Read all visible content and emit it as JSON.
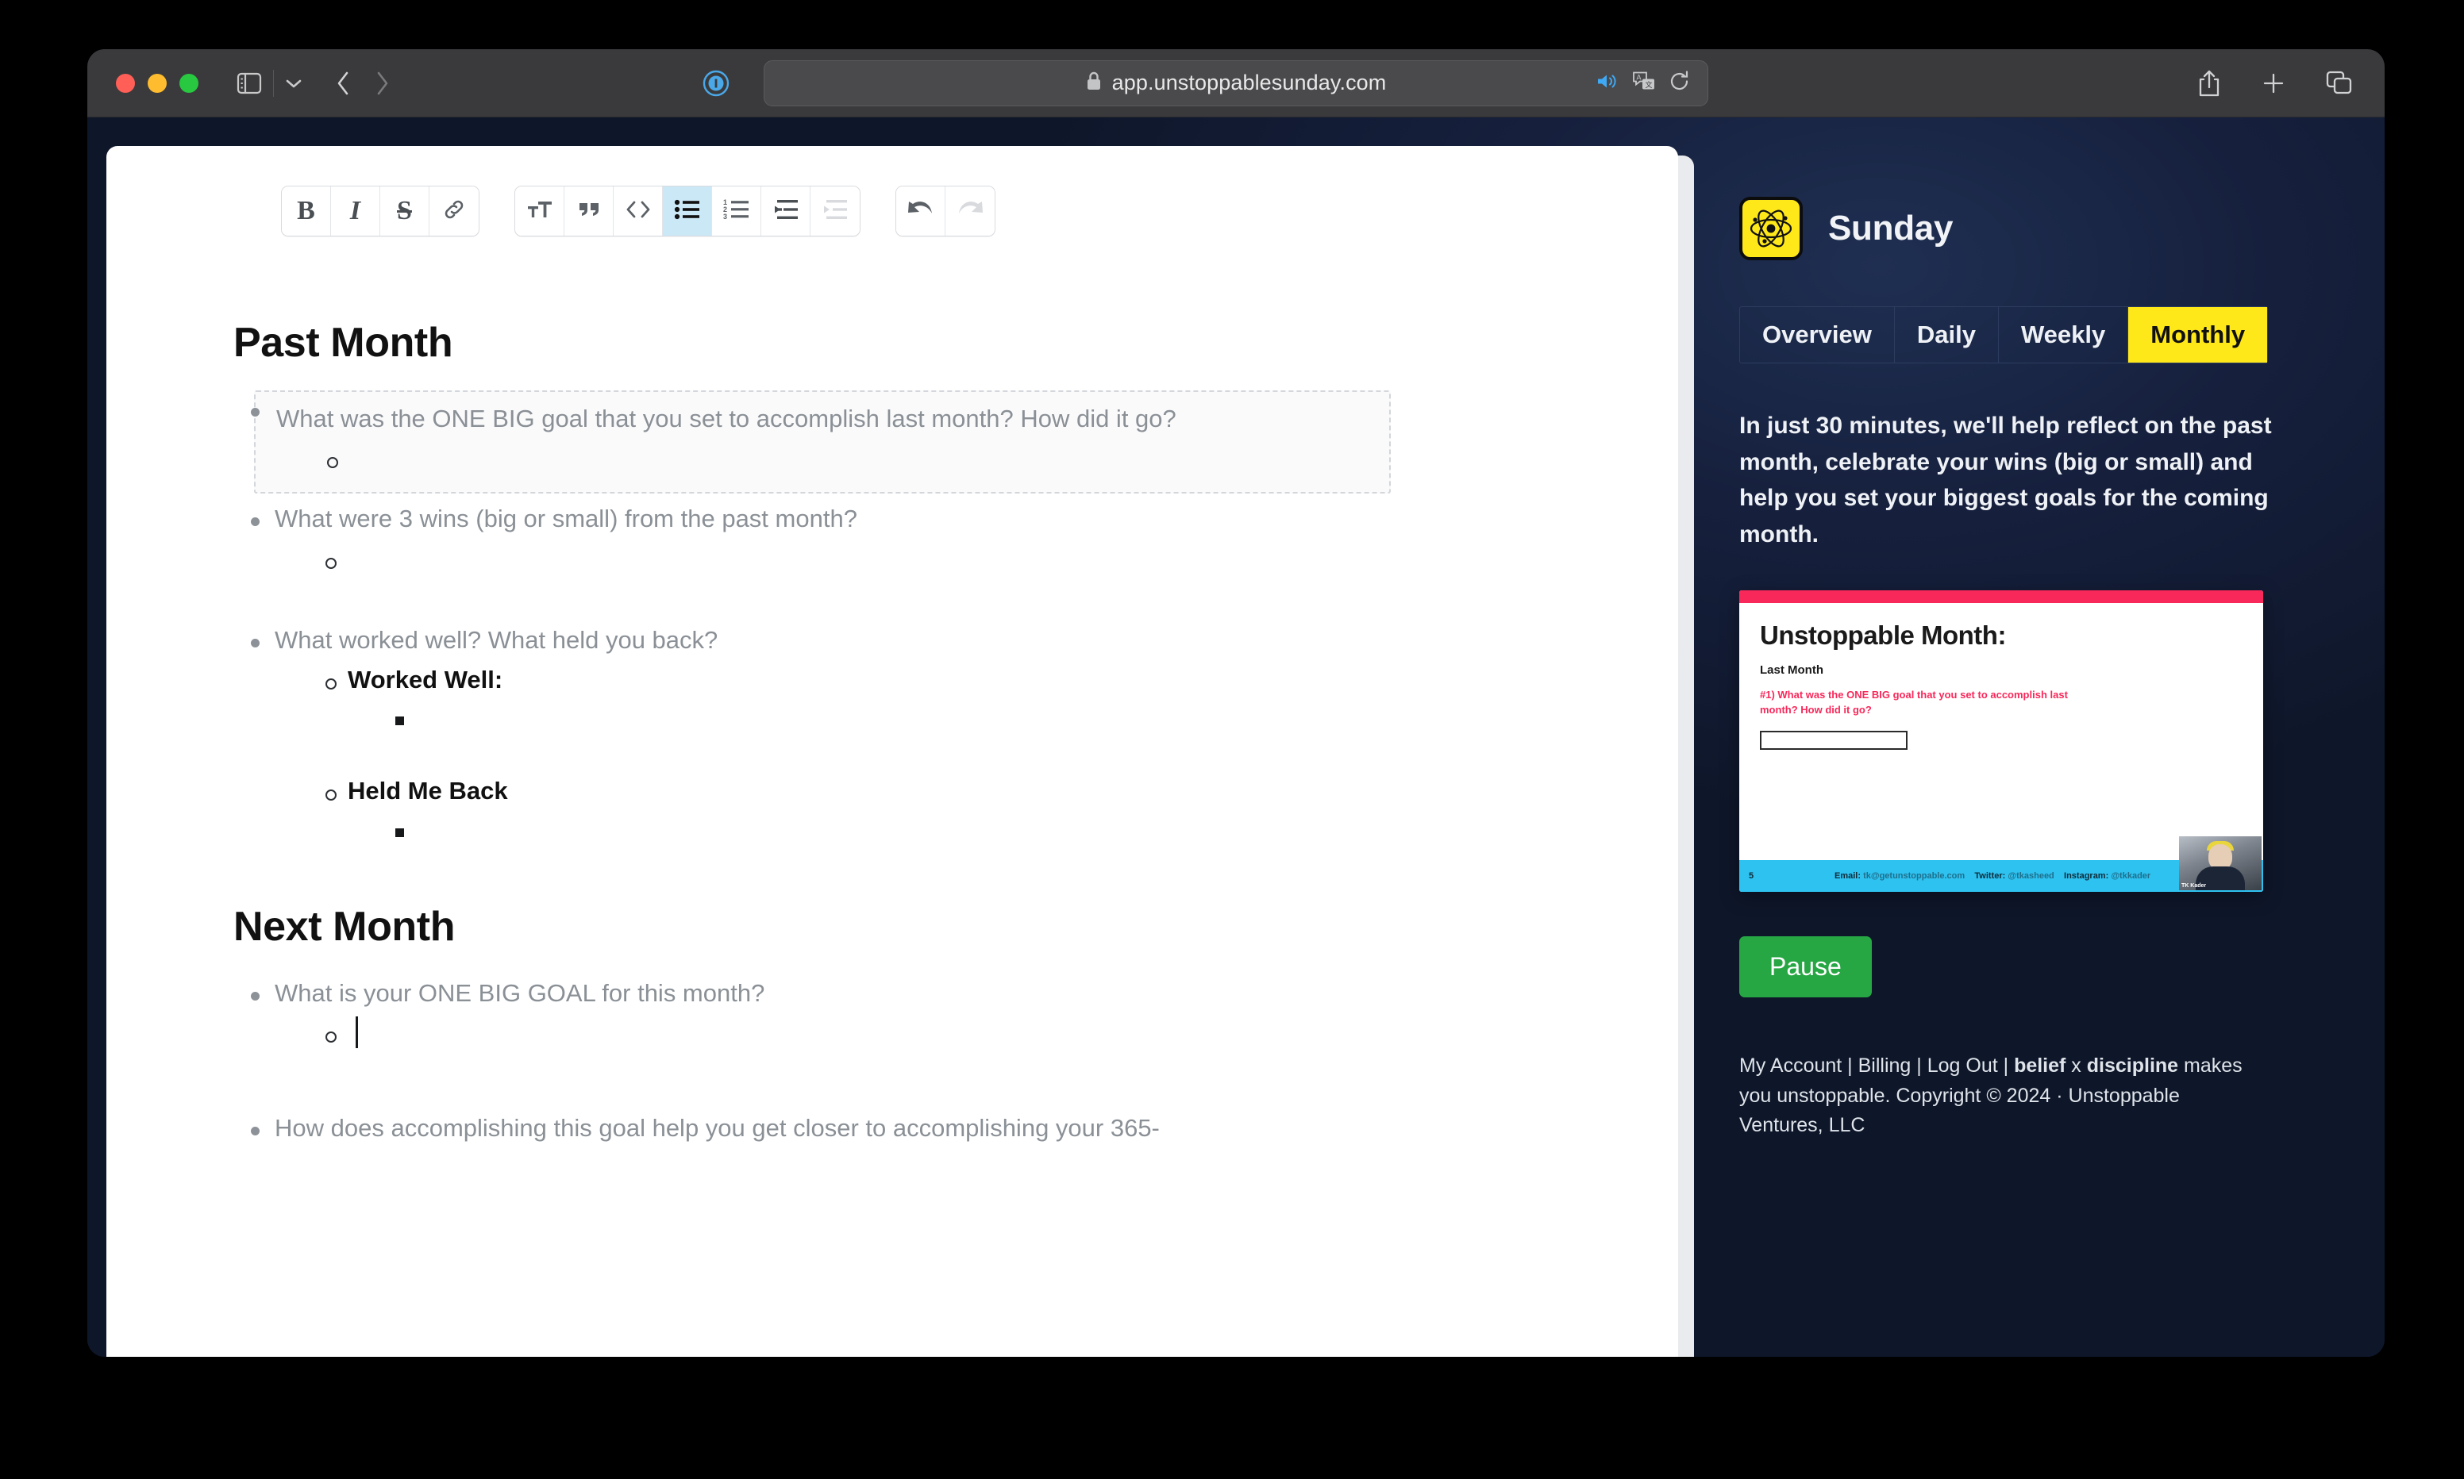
{
  "browser": {
    "url": "app.unstoppablesunday.com",
    "lock_icon": "lock-icon",
    "sidebar_icon": "sidebar-toggle-icon",
    "back_icon": "back-arrow-icon",
    "forward_icon": "forward-arrow-icon",
    "reader_icon": "reader-mode-icon",
    "shield_icon": "privacy-shield-icon",
    "audio_icon": "audio-playing-icon",
    "translate_icon": "translate-icon",
    "reload_icon": "reload-icon",
    "share_icon": "share-icon",
    "newtab_icon": "new-tab-icon",
    "tabs_icon": "tab-overview-icon"
  },
  "editor_toolbar": {
    "groups": [
      {
        "name": "inline-format",
        "buttons": [
          {
            "name": "bold-button",
            "icon": "bold-icon",
            "label": "B",
            "state": "normal"
          },
          {
            "name": "italic-button",
            "icon": "italic-icon",
            "label": "I",
            "state": "normal"
          },
          {
            "name": "strikethrough-button",
            "icon": "strikethrough-icon",
            "label": "S",
            "state": "normal"
          },
          {
            "name": "link-button",
            "icon": "link-icon",
            "label": "",
            "state": "normal"
          }
        ]
      },
      {
        "name": "block-format",
        "buttons": [
          {
            "name": "heading-button",
            "icon": "text-size-icon",
            "label": "",
            "state": "normal"
          },
          {
            "name": "blockquote-button",
            "icon": "quote-icon",
            "label": "",
            "state": "normal"
          },
          {
            "name": "code-button",
            "icon": "code-icon",
            "label": "",
            "state": "normal"
          },
          {
            "name": "bulleted-list-button",
            "icon": "bulleted-list-icon",
            "label": "",
            "state": "active"
          },
          {
            "name": "numbered-list-button",
            "icon": "numbered-list-icon",
            "label": "",
            "state": "normal"
          },
          {
            "name": "outdent-button",
            "icon": "outdent-icon",
            "label": "",
            "state": "normal"
          },
          {
            "name": "indent-button",
            "icon": "indent-icon",
            "label": "",
            "state": "disabled"
          }
        ]
      },
      {
        "name": "history",
        "buttons": [
          {
            "name": "undo-button",
            "icon": "undo-icon",
            "label": "",
            "state": "normal"
          },
          {
            "name": "redo-button",
            "icon": "redo-icon",
            "label": "",
            "state": "disabled"
          }
        ]
      }
    ]
  },
  "document": {
    "sections": [
      {
        "heading": "Past Month",
        "items": [
          {
            "text": "What was the ONE BIG goal that you set to accomplish last month? How did it go?",
            "highlighted": true,
            "children": [
              {
                "text": ""
              }
            ]
          },
          {
            "text": "What were 3 wins (big or small) from the past month?",
            "highlighted": false,
            "children": [
              {
                "text": ""
              }
            ]
          },
          {
            "text": "What worked well? What held you back?",
            "highlighted": false,
            "children": [
              {
                "text": "Worked Well:",
                "bold": true,
                "children": [
                  {
                    "text": ""
                  }
                ]
              },
              {
                "text": "Held Me Back",
                "bold": true,
                "children": [
                  {
                    "text": ""
                  }
                ]
              }
            ]
          }
        ]
      },
      {
        "heading": "Next Month",
        "items": [
          {
            "text": "What is your ONE BIG GOAL for this month?",
            "highlighted": false,
            "caret": true,
            "children": [
              {
                "text": ""
              }
            ]
          },
          {
            "text": "How does accomplishing this goal help you get closer to accomplishing your 365-",
            "highlighted": false,
            "children": []
          }
        ]
      }
    ]
  },
  "sidebar": {
    "brand": "Sunday",
    "logo_icon": "atom-logo-icon",
    "tabs": [
      {
        "label": "Overview",
        "active": false
      },
      {
        "label": "Daily",
        "active": false
      },
      {
        "label": "Weekly",
        "active": false
      },
      {
        "label": "Monthly",
        "active": true
      }
    ],
    "blurb": "In just 30 minutes, we'll help reflect on the past month, celebrate your wins (big or small) and help you set your biggest goals for the coming month.",
    "video": {
      "title": "Unstoppable Month:",
      "subtitle": "Last Month",
      "question": "#1) What was the ONE BIG goal that you set to accomplish last month? How did it go?",
      "page_number": "5",
      "footer_email_label": "Email:",
      "footer_email": "tk@getunstoppable.com",
      "footer_twitter_label": "Twitter:",
      "footer_twitter": "@tkasheed",
      "footer_instagram_label": "Instagram:",
      "footer_instagram": "@tkkader",
      "presenter_name": "TK Kader"
    },
    "pause_label": "Pause",
    "legal": {
      "my_account": "My Account",
      "billing": "Billing",
      "log_out": "Log Out",
      "sep": " | ",
      "tagline_bold_1": "belief",
      "tagline_x": " x ",
      "tagline_bold_2": "discipline",
      "tagline_rest": " makes you unstoppable. Copyright © 2024 · Unstoppable Ventures, LLC"
    }
  },
  "colors": {
    "brand_yellow": "#ffe81a",
    "pause_green": "#27a744",
    "accent_pink": "#f8285a",
    "accent_cyan": "#2ec2f0",
    "toolbar_active": "#cbe8f7",
    "sidebar_bg": "#101a33"
  }
}
